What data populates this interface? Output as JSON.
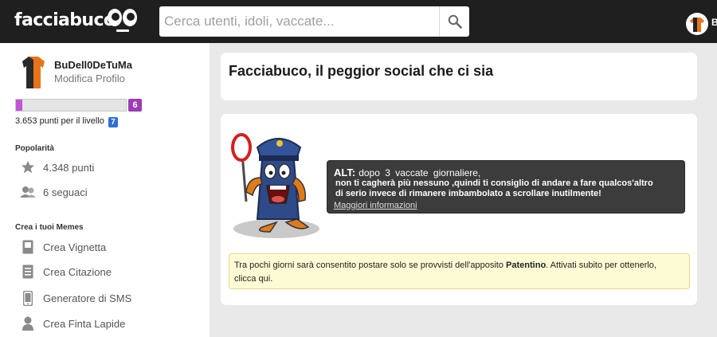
{
  "header": {
    "logo_text": "facciabuco",
    "search_placeholder": "Cerca utenti, idoli, vaccate...",
    "user_initial": "B"
  },
  "profile": {
    "username": "BuDell0DeTuMa",
    "edit_label": "Modifica Profilo",
    "level_progress": 0.06,
    "level": "6",
    "points_to_level": "3.653 punti per il livello",
    "next_level": "7"
  },
  "popularity": {
    "title": "Popolarità",
    "points": "4.348 punti",
    "followers": "6 seguaci"
  },
  "memes": {
    "title": "Crea i tuoi Memes",
    "items": [
      {
        "label": "Crea Vignetta",
        "icon": "comic-icon"
      },
      {
        "label": "Crea Citazione",
        "icon": "quote-icon"
      },
      {
        "label": "Generatore di SMS",
        "icon": "phone-icon"
      },
      {
        "label": "Crea Finta Lapide",
        "icon": "tombstone-icon"
      }
    ]
  },
  "main": {
    "title": "Facciabuco, il peggior social che ci sia",
    "alert": {
      "label": "ALT:",
      "line1": "dopo 3 vaccate giornaliere,",
      "line2": "non ti cagherà più nessuno ,quindi ti consiglio di andare a fare qualcos'altro",
      "line3": "di serio invece di rimanere imbambolato a scrollare inutilmente!",
      "link": "Maggiori informazioni"
    },
    "notice": {
      "before": "Tra pochi giorni sarà consentito postare solo se provvisti dell'apposito ",
      "bold": "Patentino",
      "after": ". Attivati subito per ottenerlo,",
      "line2": "clicca qui."
    }
  },
  "colors": {
    "topbar": "#1f1f1f",
    "progress_fill": "#c356d6",
    "level_badge": "#9b3db3",
    "next_level_badge": "#2f6fd4",
    "notice_bg": "#fdfbd4"
  }
}
